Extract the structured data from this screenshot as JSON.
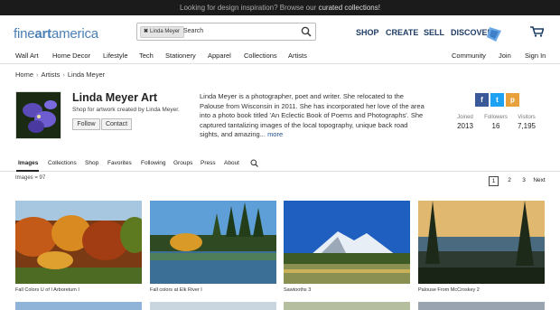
{
  "promo": {
    "text": "Looking for design inspiration? Browse our",
    "link": "curated collections!"
  },
  "header": {
    "logo_light": "fine",
    "logo_bold": "art",
    "logo_end": "america",
    "search_chip": "Linda Meyer",
    "search_placeholder": "Search",
    "nav": [
      "SHOP",
      "CREATE",
      "SELL",
      "DISCOVER"
    ]
  },
  "subnav": {
    "left": [
      "Wall Art",
      "Home Decor",
      "Lifestyle",
      "Tech",
      "Stationery",
      "Apparel",
      "Collections",
      "Artists"
    ],
    "right": [
      "Community",
      "Join",
      "Sign In"
    ]
  },
  "breadcrumb": [
    "Home",
    "Artists",
    "Linda Meyer"
  ],
  "profile": {
    "name": "Linda Meyer Art",
    "subtitle": "Shop for artwork created by Linda Meyer.",
    "follow": "Follow",
    "contact": "Contact",
    "bio": "Linda Meyer is a photographer, poet and writer.  She relocated to the Palouse from Wisconsin in 2011.  She has incorporated her love of the area into a photo book titled 'An Eclectic Book of Poems and Photographs'.  She captured tantalizing images of the local topography, unique back road sights, and amazing...",
    "more": "more",
    "social": {
      "facebook": "f",
      "twitter": "t",
      "pinterest": "p"
    },
    "stats": [
      {
        "label": "Joined",
        "value": "2013"
      },
      {
        "label": "Followers",
        "value": "16"
      },
      {
        "label": "Visitors",
        "value": "7,195"
      }
    ]
  },
  "tabs": [
    "Images",
    "Collections",
    "Shop",
    "Favorites",
    "Following",
    "Groups",
    "Press",
    "About"
  ],
  "gallery": {
    "count": "Images = 97",
    "pages": [
      "1",
      "2",
      "3",
      "Next"
    ],
    "items": [
      {
        "title": "Fall Colors U of I Arboretum I"
      },
      {
        "title": "Fall colors at Elk River I"
      },
      {
        "title": "Sawtooths 3"
      },
      {
        "title": "Palouse From McCroskey 2"
      }
    ]
  },
  "colors": {
    "accent": "#1f3d66",
    "logo": "#4a7fb5",
    "facebook": "#3b5998",
    "twitter": "#1da1f2",
    "pinterest": "#e8a13a"
  }
}
